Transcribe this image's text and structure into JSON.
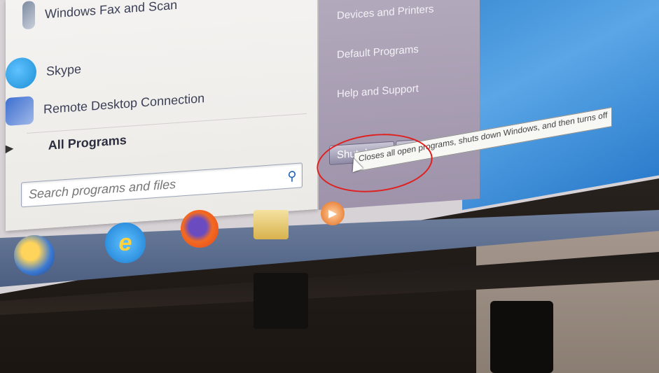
{
  "start_menu": {
    "programs": [
      {
        "label": "Windows Fax and Scan",
        "icon": "fax-scan-icon"
      },
      {
        "label": "Skype",
        "icon": "skype-icon"
      },
      {
        "label": "Remote Desktop Connection",
        "icon": "remote-desktop-icon"
      }
    ],
    "all_programs_label": "All Programs",
    "search": {
      "placeholder": "Search programs and files"
    },
    "right_links": [
      "Devices and Printers",
      "Default Programs",
      "Help and Support"
    ],
    "shutdown_label": "Shut down",
    "tooltip": "Closes all open programs, shuts down Windows, and then turns off"
  },
  "taskbar": {
    "items": [
      "start-orb",
      "internet-explorer-icon",
      "firefox-icon",
      "file-explorer-icon",
      "media-player-icon"
    ]
  },
  "colors": {
    "annotation_circle": "#e0201f",
    "right_pane": "#a89db4",
    "desktop": "#4a9ae0"
  }
}
